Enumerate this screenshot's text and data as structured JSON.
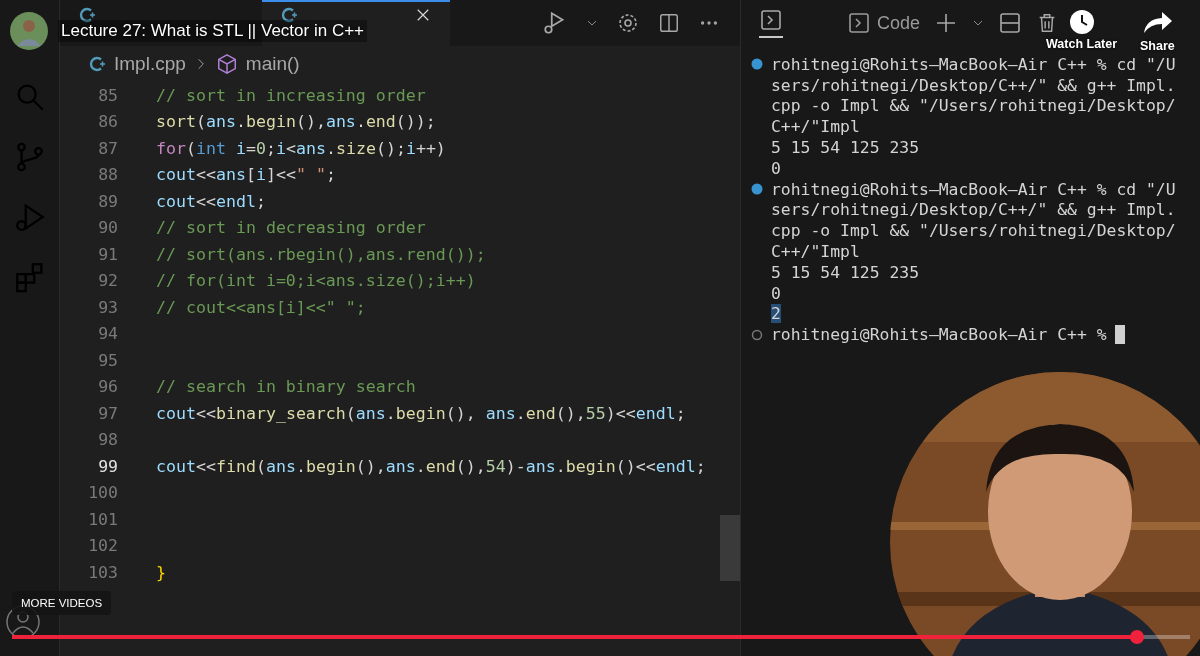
{
  "video": {
    "title": "Lecture 27: What is STL || Vector in C++",
    "watch_later": "Watch Later",
    "share": "Share",
    "more_videos": "MORE VIDEOS",
    "progress": {
      "level": 0.955
    }
  },
  "editor": {
    "tabs": [
      {
        "selected": false
      },
      {
        "selected": true
      }
    ],
    "breadcrumb": {
      "file": "Impl.cpp",
      "symbol": "main()"
    },
    "lines": [
      {
        "number": "85",
        "current": false,
        "tokens": [
          {
            "kind": "comment",
            "text": "// sort in increasing order"
          }
        ]
      },
      {
        "number": "86",
        "current": false,
        "tokens": [
          {
            "kind": "fn",
            "text": "sort"
          },
          {
            "kind": "plain",
            "text": "("
          },
          {
            "kind": "var",
            "text": "ans"
          },
          {
            "kind": "plain",
            "text": "."
          },
          {
            "kind": "fn",
            "text": "begin"
          },
          {
            "kind": "plain",
            "text": "(),"
          },
          {
            "kind": "var",
            "text": "ans"
          },
          {
            "kind": "plain",
            "text": "."
          },
          {
            "kind": "fn",
            "text": "end"
          },
          {
            "kind": "plain",
            "text": "());"
          }
        ]
      },
      {
        "number": "87",
        "current": false,
        "tokens": [
          {
            "kind": "control",
            "text": "for"
          },
          {
            "kind": "plain",
            "text": "("
          },
          {
            "kind": "keyword",
            "text": "int"
          },
          {
            "kind": "var",
            "text": " i"
          },
          {
            "kind": "plain",
            "text": "="
          },
          {
            "kind": "number",
            "text": "0"
          },
          {
            "kind": "plain",
            "text": ";"
          },
          {
            "kind": "var",
            "text": "i"
          },
          {
            "kind": "plain",
            "text": "<"
          },
          {
            "kind": "var",
            "text": "ans"
          },
          {
            "kind": "plain",
            "text": "."
          },
          {
            "kind": "fn",
            "text": "size"
          },
          {
            "kind": "plain",
            "text": "();"
          },
          {
            "kind": "var",
            "text": "i"
          },
          {
            "kind": "plain",
            "text": "++)"
          }
        ]
      },
      {
        "number": "88",
        "current": false,
        "tokens": [
          {
            "kind": "var",
            "text": "cout"
          },
          {
            "kind": "plain",
            "text": "<<"
          },
          {
            "kind": "var",
            "text": "ans"
          },
          {
            "kind": "plain",
            "text": "["
          },
          {
            "kind": "var",
            "text": "i"
          },
          {
            "kind": "plain",
            "text": "]<<"
          },
          {
            "kind": "string",
            "text": "\" \""
          },
          {
            "kind": "plain",
            "text": ";"
          }
        ]
      },
      {
        "number": "89",
        "current": false,
        "tokens": [
          {
            "kind": "var",
            "text": "cout"
          },
          {
            "kind": "plain",
            "text": "<<"
          },
          {
            "kind": "var",
            "text": "endl"
          },
          {
            "kind": "plain",
            "text": ";"
          }
        ]
      },
      {
        "number": "90",
        "current": false,
        "tokens": [
          {
            "kind": "comment",
            "text": "// sort in decreasing order"
          }
        ]
      },
      {
        "number": "91",
        "current": false,
        "tokens": [
          {
            "kind": "comment",
            "text": "// sort(ans.rbegin(),ans.rend());"
          }
        ]
      },
      {
        "number": "92",
        "current": false,
        "tokens": [
          {
            "kind": "comment",
            "text": "// for(int i=0;i<ans.size();i++)"
          }
        ]
      },
      {
        "number": "93",
        "current": false,
        "tokens": [
          {
            "kind": "comment",
            "text": "// cout<<ans[i]<<\" \";"
          }
        ]
      },
      {
        "number": "94",
        "current": false
      },
      {
        "number": "95",
        "current": false
      },
      {
        "number": "96",
        "current": false,
        "tokens": [
          {
            "kind": "comment",
            "text": "// search in binary search"
          }
        ]
      },
      {
        "number": "97",
        "current": false,
        "tokens": [
          {
            "kind": "var",
            "text": "cout"
          },
          {
            "kind": "plain",
            "text": "<<"
          },
          {
            "kind": "fn",
            "text": "binary_search"
          },
          {
            "kind": "plain",
            "text": "("
          },
          {
            "kind": "var",
            "text": "ans"
          },
          {
            "kind": "plain",
            "text": "."
          },
          {
            "kind": "fn",
            "text": "begin"
          },
          {
            "kind": "plain",
            "text": "(), "
          },
          {
            "kind": "var",
            "text": "ans"
          },
          {
            "kind": "plain",
            "text": "."
          },
          {
            "kind": "fn",
            "text": "end"
          },
          {
            "kind": "plain",
            "text": "(),"
          },
          {
            "kind": "number",
            "text": "55"
          },
          {
            "kind": "plain",
            "text": ")<<"
          },
          {
            "kind": "var",
            "text": "endl"
          },
          {
            "kind": "plain",
            "text": ";"
          }
        ]
      },
      {
        "number": "98",
        "current": false
      },
      {
        "number": "99",
        "current": true,
        "tokens": [
          {
            "kind": "var",
            "text": "cout"
          },
          {
            "kind": "plain",
            "text": "<<"
          },
          {
            "kind": "fn",
            "text": "find"
          },
          {
            "kind": "plain",
            "text": "("
          },
          {
            "kind": "var",
            "text": "ans"
          },
          {
            "kind": "plain",
            "text": "."
          },
          {
            "kind": "fn",
            "text": "begin"
          },
          {
            "kind": "plain",
            "text": "(),"
          },
          {
            "kind": "var",
            "text": "ans"
          },
          {
            "kind": "plain",
            "text": "."
          },
          {
            "kind": "fn",
            "text": "end"
          },
          {
            "kind": "plain",
            "text": "(),"
          },
          {
            "kind": "number",
            "text": "54"
          },
          {
            "kind": "plain",
            "text": ")-"
          },
          {
            "kind": "var",
            "text": "ans"
          },
          {
            "kind": "plain",
            "text": "."
          },
          {
            "kind": "fn",
            "text": "begin"
          },
          {
            "kind": "plain",
            "text": "()<<"
          },
          {
            "kind": "var",
            "text": "endl"
          },
          {
            "kind": "plain",
            "text": ";"
          }
        ]
      },
      {
        "number": "100",
        "current": false
      },
      {
        "number": "101",
        "current": false
      },
      {
        "number": "102",
        "current": false
      },
      {
        "number": "103",
        "current": false,
        "tokens": [
          {
            "kind": "brace",
            "text": "}"
          }
        ]
      }
    ]
  },
  "terminal": {
    "new_label": "Code",
    "lines": [
      {
        "kind": "prompt-done",
        "text": "rohitnegi@Rohits—MacBook—Air C++ % cd \"/U"
      },
      {
        "kind": "output",
        "text": "sers/rohitnegi/Desktop/C++/\" && g++ Impl."
      },
      {
        "kind": "output",
        "text": "cpp -o Impl && \"/Users/rohitnegi/Desktop/"
      },
      {
        "kind": "output",
        "text": "C++/\"Impl"
      },
      {
        "kind": "output",
        "text": "5 15 54 125 235"
      },
      {
        "kind": "output",
        "text": "0"
      },
      {
        "kind": "prompt-done",
        "text": "rohitnegi@Rohits—MacBook—Air C++ % cd \"/U"
      },
      {
        "kind": "output",
        "text": "sers/rohitnegi/Desktop/C++/\" && g++ Impl."
      },
      {
        "kind": "output",
        "text": "cpp -o Impl && \"/Users/rohitnegi/Desktop/"
      },
      {
        "kind": "output",
        "text": "C++/\"Impl"
      },
      {
        "kind": "output",
        "text": "5 15 54 125 235"
      },
      {
        "kind": "output",
        "text": "0"
      },
      {
        "kind": "selected-output",
        "text": "2"
      },
      {
        "kind": "prompt-idle",
        "text": "rohitnegi@Rohits—MacBook—Air C++ %"
      }
    ]
  }
}
